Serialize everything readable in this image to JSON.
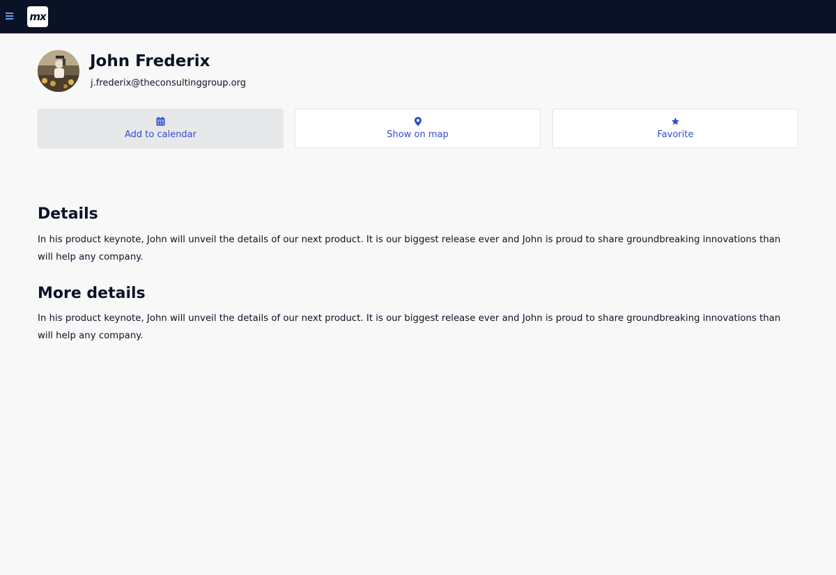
{
  "colors": {
    "topbar": "#0a1325",
    "accent": "#2f4ec8",
    "background": "#f8f8f8"
  },
  "topbar": {
    "menu_icon": "hamburger-icon",
    "logo_text": "mx"
  },
  "profile": {
    "name": "John Frederix",
    "email": "j.frederix@theconsultinggroup.org"
  },
  "actions": [
    {
      "label": "Add to calendar",
      "icon": "calendar-icon"
    },
    {
      "label": "Show on map",
      "icon": "map-pin-icon"
    },
    {
      "label": "Favorite",
      "icon": "star-icon"
    }
  ],
  "sections": [
    {
      "title": "Details",
      "body": "In his product keynote, John will unveil the details of our next product. It is our biggest release ever and John is proud to share groundbreaking innovations than will help any company."
    },
    {
      "title": "More details",
      "body": "In his product keynote, John will unveil the details of our next product. It is our biggest release ever and John is proud to share groundbreaking innovations than will help any company."
    }
  ]
}
